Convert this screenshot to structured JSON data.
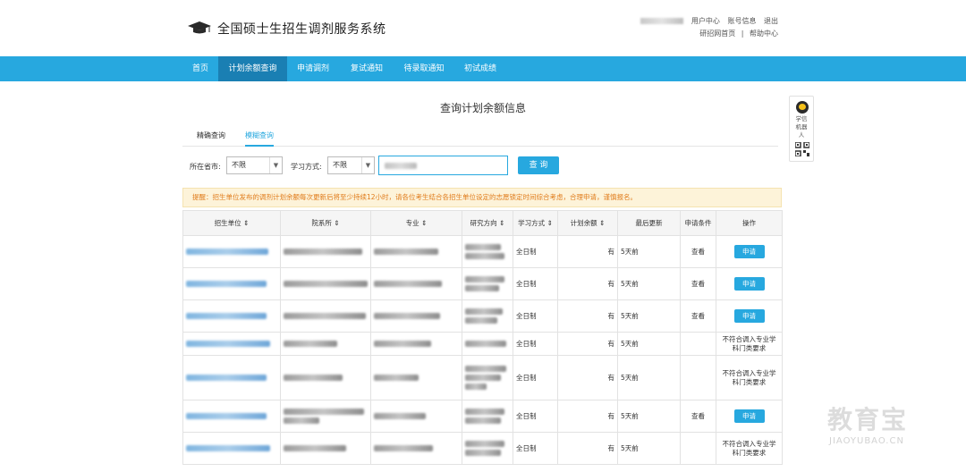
{
  "header": {
    "title": "全国硕士生招生调剂服务系统",
    "links_row1": [
      "用户中心",
      "账号信息",
      "退出"
    ],
    "links_row2": [
      "研招网首页",
      "|",
      "帮助中心"
    ]
  },
  "nav": {
    "items": [
      "首页",
      "计划余额查询",
      "申请调剂",
      "复试通知",
      "待录取通知",
      "初试成绩"
    ],
    "active_index": 1
  },
  "main": {
    "heading": "查询计划余额信息",
    "tabs": [
      "精确查询",
      "模糊查询"
    ],
    "active_tab": 1
  },
  "filters": {
    "province_label": "所在省市:",
    "province_value": "不限",
    "mode_label": "学习方式:",
    "mode_value": "不限",
    "search_button": "查 询"
  },
  "notice": "提醒：招生单位发布的调剂计划余额每次更新后将至少持续12小时，请各位考生结合各招生单位设定的志愿锁定时间综合考虑，合理申请，谨慎报名。",
  "table": {
    "headers": [
      "招生单位 ⇕",
      "院系所 ⇕",
      "专业 ⇕",
      "研究方向 ⇕",
      "学习方式 ⇕",
      "计划余额 ⇕",
      "最后更新",
      "申请条件",
      "操作"
    ],
    "rows": [
      {
        "mode": "全日制",
        "balance": "有",
        "updated": "5天前",
        "condition": "查看",
        "action": "申请"
      },
      {
        "mode": "全日制",
        "balance": "有",
        "updated": "5天前",
        "condition": "查看",
        "action": "申请"
      },
      {
        "mode": "全日制",
        "balance": "有",
        "updated": "5天前",
        "condition": "查看",
        "action": "申请"
      },
      {
        "mode": "全日制",
        "balance": "有",
        "updated": "5天前",
        "condition": "",
        "action": "不符合调入专业学科门类要求"
      },
      {
        "mode": "全日制",
        "balance": "有",
        "updated": "5天前",
        "condition": "",
        "action": "不符合调入专业学科门类要求"
      },
      {
        "mode": "全日制",
        "balance": "有",
        "updated": "5天前",
        "condition": "查看",
        "action": "申请"
      },
      {
        "mode": "全日制",
        "balance": "有",
        "updated": "5天前",
        "condition": "",
        "action": "不符合调入专业学科门类要求"
      }
    ]
  },
  "side_widget": {
    "robot_label": "学信机器人",
    "robot_icon": "robot-icon",
    "qr_icon": "qr-code-icon"
  },
  "watermark": {
    "cn": "教育宝",
    "en": "JIAOYUBAO.CN"
  },
  "colors": {
    "accent": "#27a8df",
    "nav_active": "#1a7fb3",
    "notice_bg": "#fdf3d9",
    "notice_text": "#e07b1a"
  }
}
